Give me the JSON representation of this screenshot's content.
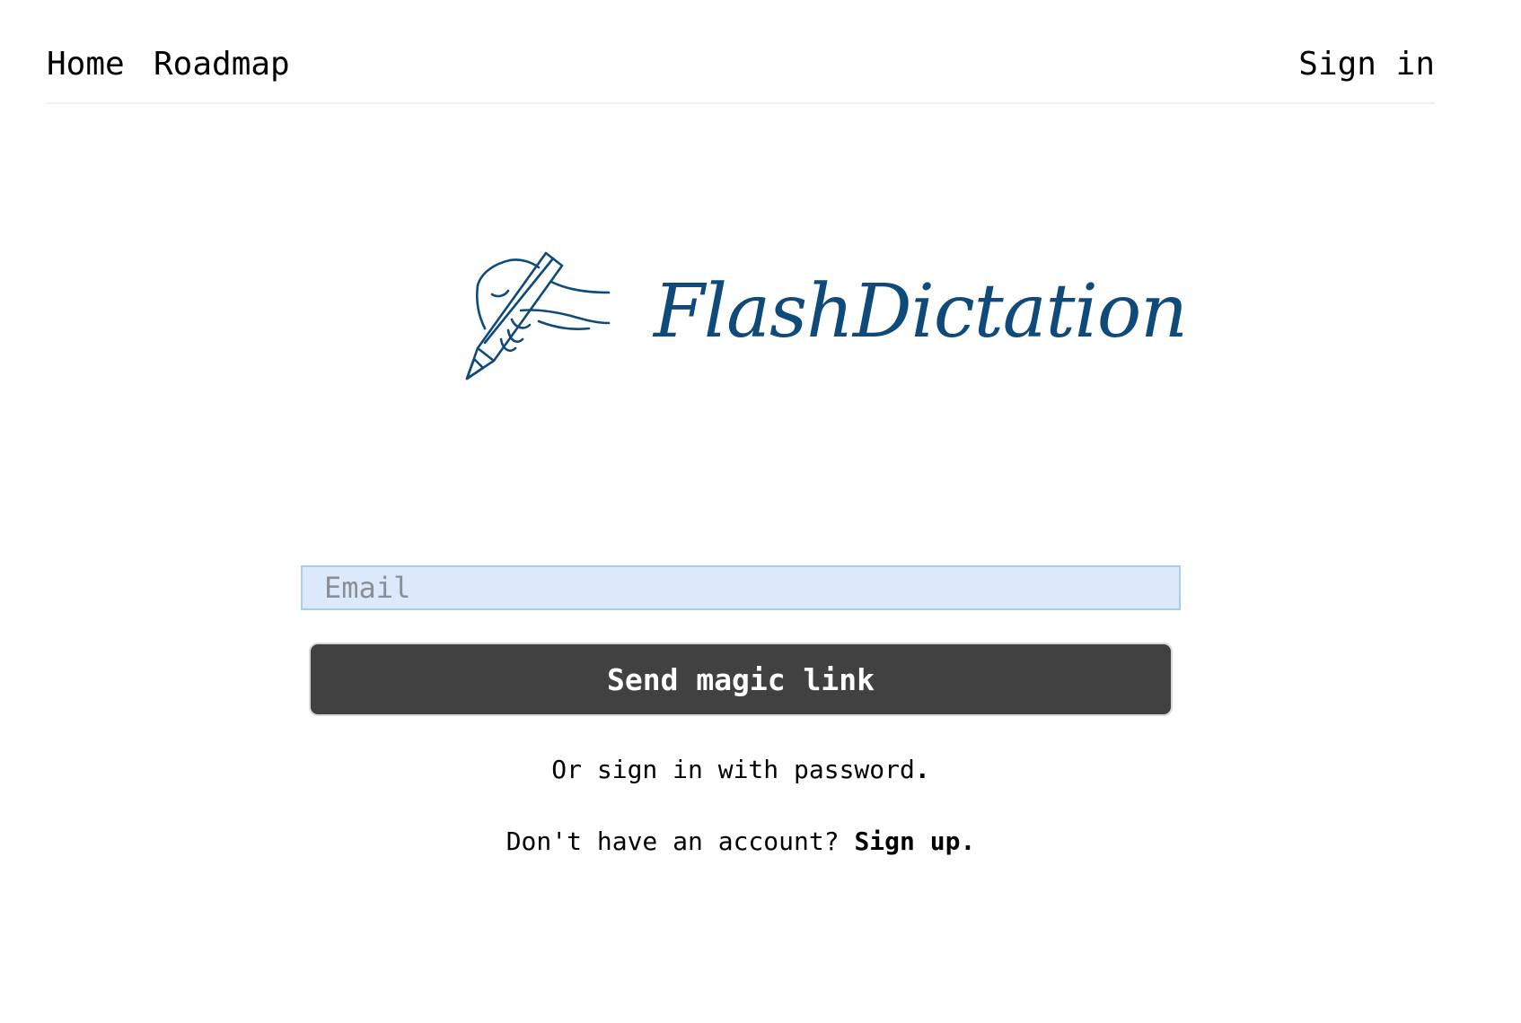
{
  "nav": {
    "home_label": "Home",
    "roadmap_label": "Roadmap",
    "signin_label": "Sign in"
  },
  "brand": {
    "name": "FlashDictation",
    "color": "#0e4a7a"
  },
  "form": {
    "email_placeholder": "Email",
    "email_value": "",
    "submit_label": "Send magic link"
  },
  "links": {
    "password_text": "Or sign in with password",
    "password_dot": ".",
    "signup_prompt": "Don't have an account?",
    "signup_label": "Sign up."
  },
  "colors": {
    "button_bg": "#414141",
    "input_bg": "#dce9fb",
    "input_border": "#a8cdf2"
  }
}
